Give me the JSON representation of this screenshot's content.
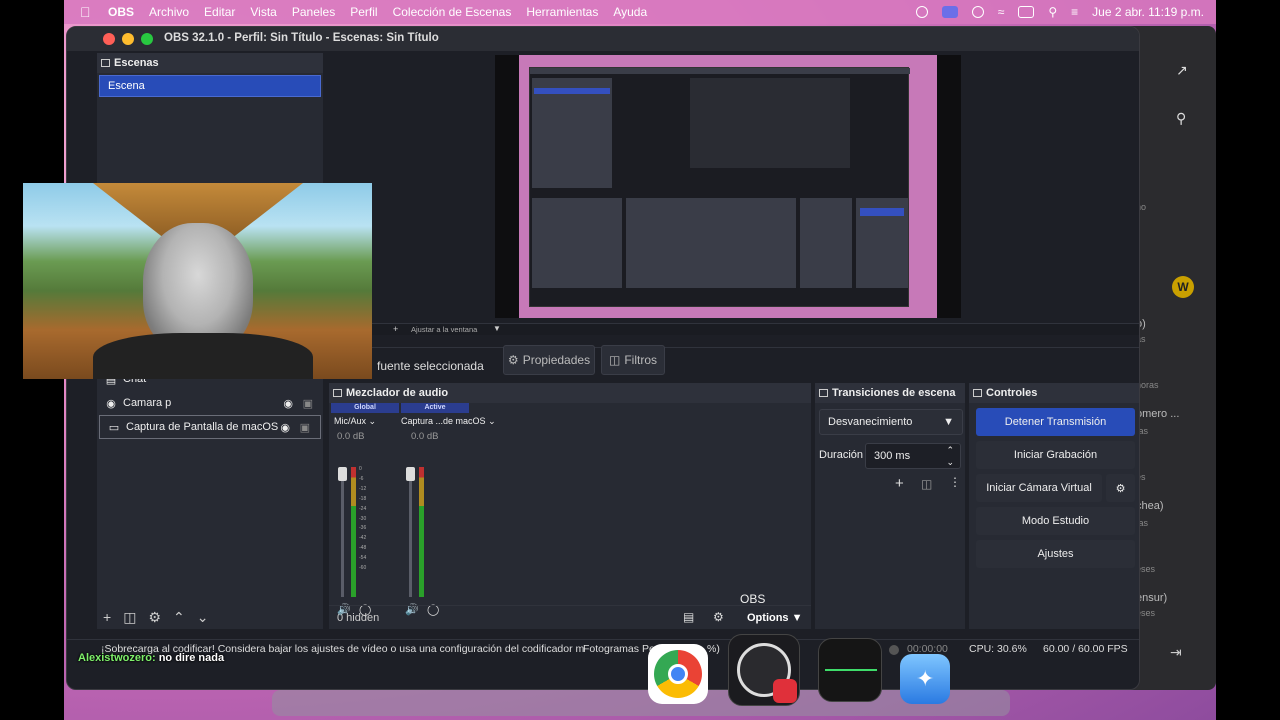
{
  "menubar": {
    "app": "OBS",
    "items": [
      "Archivo",
      "Editar",
      "Vista",
      "Paneles",
      "Perfil",
      "Colección de Escenas",
      "Herramientas",
      "Ayuda"
    ],
    "clock": "Jue 2 abr.  11:19 p.m."
  },
  "window": {
    "title": "OBS 32.1.0 - Perfil: Sin Título - Escenas: Sin Título"
  },
  "scenes": {
    "title": "Escenas",
    "items": [
      "Escena"
    ]
  },
  "preview": {
    "bottom_tab": "Ajustar a la ventana"
  },
  "context": {
    "selection_label": "fuente seleccionada",
    "properties": "Propiedades",
    "filters": "Filtros"
  },
  "sources": {
    "items": [
      {
        "name": "Chat",
        "icon": "chat-icon"
      },
      {
        "name": "Camara p",
        "icon": "camera-icon"
      },
      {
        "name": "Captura de Pantalla de macOS",
        "icon": "display-icon"
      }
    ]
  },
  "mixer": {
    "title": "Mezclador de audio",
    "channels": [
      {
        "tag": "Global",
        "name": "Mic/Aux",
        "db": "0.0 dB"
      },
      {
        "tag": "Active",
        "name": "Captura ...de macOS",
        "db": "0.0 dB"
      }
    ],
    "scale": [
      "0",
      "-6",
      "-12",
      "-18",
      "-24",
      "-30",
      "-36",
      "-42",
      "-48",
      "-54",
      "-60"
    ],
    "hidden": "0 hidden",
    "options": "Options"
  },
  "transitions": {
    "title": "Transiciones de escena",
    "selected": "Desvanecimiento",
    "duration_label": "Duración",
    "duration_value": "300 ms"
  },
  "controls": {
    "title": "Controles",
    "stop_stream": "Detener Transmisión",
    "start_record": "Iniciar Grabación",
    "virtual_cam": "Iniciar Cámara Virtual",
    "studio_mode": "Modo Estudio",
    "settings": "Ajustes"
  },
  "status": {
    "warning": "¡Sobrecarga al codificar! Considera bajar los ajustes de vídeo o usa una configuración del codificador m",
    "frames": "Fotogramas Pe",
    "frames_suffix": "%)",
    "rec_time": "00:00:00",
    "cpu": "CPU: 30.6%",
    "fps": "60.00 / 60.00 FPS"
  },
  "chat": {
    "user": "Alexistwozero:",
    "message": " no dire nada"
  },
  "dock": {
    "tooltip": "OBS"
  },
  "backdrop": {
    "lines": [
      "no",
      "o)",
      "as",
      "horas",
      "omero ...",
      "ías",
      "es",
      "chea)",
      "ías",
      "eses",
      "ensur)",
      "eses"
    ]
  },
  "colors": {
    "accent": "#284cb8",
    "panel": "#272a33",
    "background": "#1d1f26",
    "meter_green": "#3fbf3f",
    "meter_red": "#d03030"
  }
}
